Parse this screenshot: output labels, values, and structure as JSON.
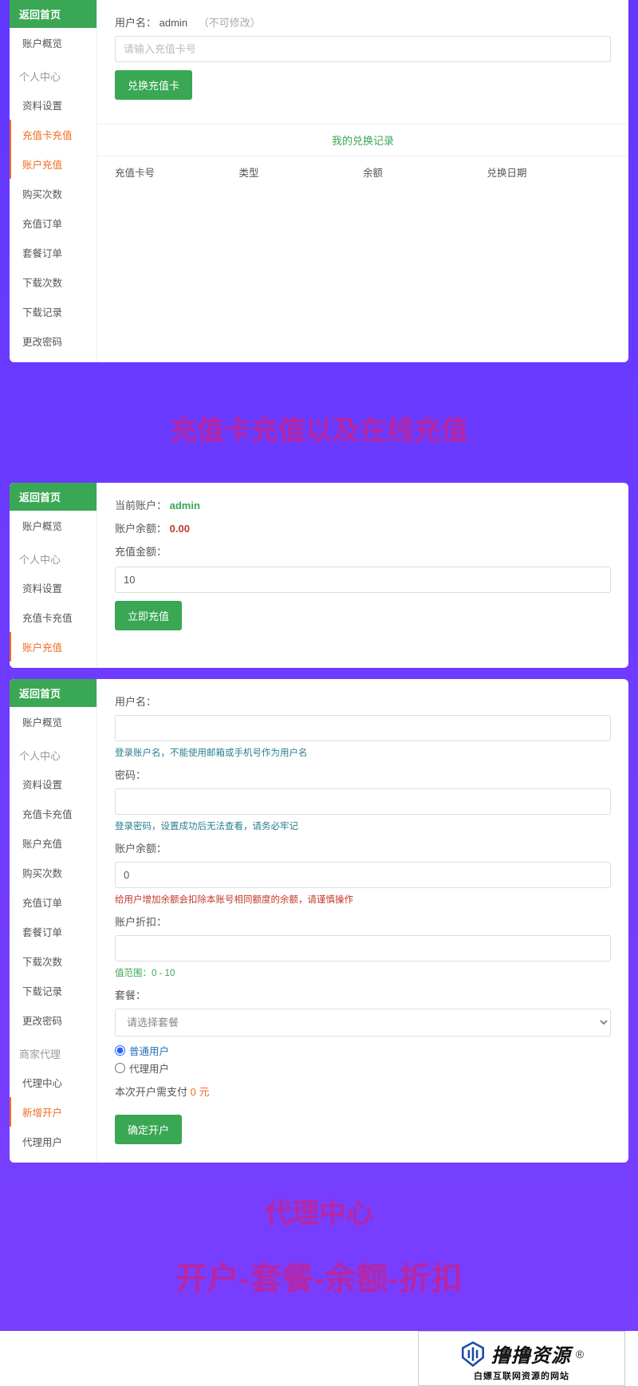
{
  "common": {
    "return_home": "返回首页",
    "account_overview": "账户概览",
    "personal_center": "个人中心",
    "merchant_agent": "商家代理",
    "menu": {
      "profile": "资料设置",
      "card_recharge": "充值卡充值",
      "account_recharge": "账户充值",
      "purchase_count": "购买次数",
      "recharge_orders": "充值订单",
      "package_orders": "套餐订单",
      "download_count": "下载次数",
      "download_records": "下载记录",
      "change_pwd": "更改密码",
      "agent_center": "代理中心",
      "new_account": "新增开户",
      "agent_users": "代理用户"
    }
  },
  "panel1": {
    "username_label": "用户名：",
    "username_value": "admin",
    "username_note": "（不可修改）",
    "card_placeholder": "请输入充值卡号",
    "redeem_btn": "兑换充值卡",
    "records_title": "我的兑换记录",
    "cols": {
      "card_no": "充值卡号",
      "type": "类型",
      "balance": "余额",
      "date": "兑换日期"
    }
  },
  "caption1": "充值卡充值以及在线充值",
  "panel2": {
    "current_account_label": "当前账户：",
    "current_account_value": "admin",
    "balance_label": "账户余额：",
    "balance_value": "0.00",
    "amount_label": "充值金额：",
    "amount_value": "10",
    "recharge_btn": "立即充值"
  },
  "panel3": {
    "username_label": "用户名：",
    "username_hint": "登录账户名，不能使用邮箱或手机号作为用户名",
    "password_label": "密码：",
    "password_hint": "登录密码，设置成功后无法查看，请务必牢记",
    "balance_label": "账户余额：",
    "balance_value": "0",
    "balance_hint": "给用户增加余额会扣除本账号相同额度的余额，请谨慎操作",
    "discount_label": "账户折扣：",
    "discount_hint": "值范围：0 - 10",
    "package_label": "套餐：",
    "package_placeholder": "请选择套餐",
    "radio_normal": "普通用户",
    "radio_agent": "代理用户",
    "pay_label": "本次开户需支付",
    "pay_value": "0",
    "pay_unit": "元",
    "confirm_btn": "确定开户"
  },
  "caption2": "代理中心",
  "caption3": "开户-套餐-余额-折扣",
  "logo": {
    "brand": "撸撸资源",
    "sub": "白嫖互联网资源的网站"
  }
}
